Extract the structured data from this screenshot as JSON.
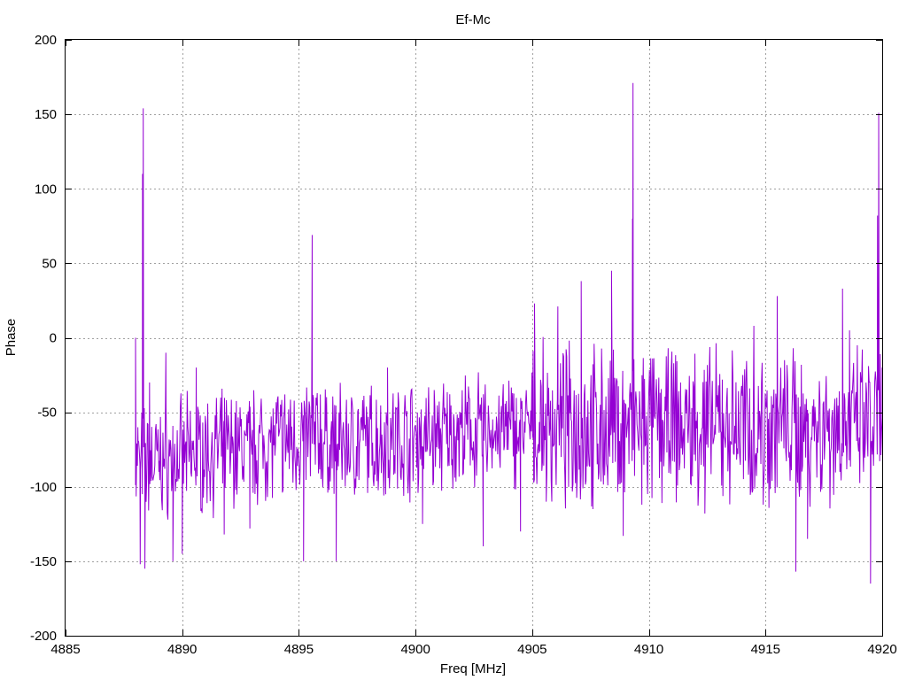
{
  "chart_data": {
    "type": "line",
    "title": "Ef-Mc",
    "xlabel": "Freq [MHz]",
    "ylabel": "Phase",
    "xlim": [
      4885,
      4920
    ],
    "ylim": [
      -200,
      200
    ],
    "xticks": [
      4885,
      4890,
      4895,
      4900,
      4905,
      4910,
      4915,
      4920
    ],
    "yticks": [
      -200,
      -150,
      -100,
      -50,
      0,
      50,
      100,
      150,
      200
    ],
    "grid": true,
    "legend": "none",
    "series_color": "#9400d3",
    "series": [
      {
        "x_start": 4888.0,
        "x_end": 4920.0,
        "noise_points": 1200,
        "points": [
          {
            "x": 4888.0,
            "y": 0
          },
          {
            "x": 4888.1,
            "y": -60
          },
          {
            "x": 4888.2,
            "y": -152
          },
          {
            "x": 4888.3,
            "y": 110
          },
          {
            "x": 4888.33,
            "y": 154
          },
          {
            "x": 4888.4,
            "y": -155
          },
          {
            "x": 4888.6,
            "y": -30
          },
          {
            "x": 4889.0,
            "y": -90
          },
          {
            "x": 4889.3,
            "y": -10
          },
          {
            "x": 4889.6,
            "y": -150
          },
          {
            "x": 4890.0,
            "y": -145
          },
          {
            "x": 4890.6,
            "y": -20
          },
          {
            "x": 4891.8,
            "y": -132
          },
          {
            "x": 4892.9,
            "y": -128
          },
          {
            "x": 4894.4,
            "y": -40
          },
          {
            "x": 4895.2,
            "y": -150
          },
          {
            "x": 4895.57,
            "y": 69
          },
          {
            "x": 4896.6,
            "y": -150
          },
          {
            "x": 4898.8,
            "y": -20
          },
          {
            "x": 4900.3,
            "y": -125
          },
          {
            "x": 4902.9,
            "y": -140
          },
          {
            "x": 4904.5,
            "y": -130
          },
          {
            "x": 4905.1,
            "y": 23
          },
          {
            "x": 4905.6,
            "y": -110
          },
          {
            "x": 4906.1,
            "y": 21
          },
          {
            "x": 4907.1,
            "y": 38
          },
          {
            "x": 4907.6,
            "y": -115
          },
          {
            "x": 4908.4,
            "y": 45
          },
          {
            "x": 4908.9,
            "y": -133
          },
          {
            "x": 4909.3,
            "y": 80
          },
          {
            "x": 4909.32,
            "y": 171
          },
          {
            "x": 4909.7,
            "y": -112
          },
          {
            "x": 4912.4,
            "y": -118
          },
          {
            "x": 4914.5,
            "y": 8
          },
          {
            "x": 4914.9,
            "y": -112
          },
          {
            "x": 4915.5,
            "y": 28
          },
          {
            "x": 4916.3,
            "y": -157
          },
          {
            "x": 4916.8,
            "y": -135
          },
          {
            "x": 4918.3,
            "y": 33
          },
          {
            "x": 4918.6,
            "y": 5
          },
          {
            "x": 4919.5,
            "y": -165
          },
          {
            "x": 4919.8,
            "y": 82
          },
          {
            "x": 4919.85,
            "y": 151
          },
          {
            "x": 4920.0,
            "y": -20
          }
        ]
      }
    ]
  }
}
